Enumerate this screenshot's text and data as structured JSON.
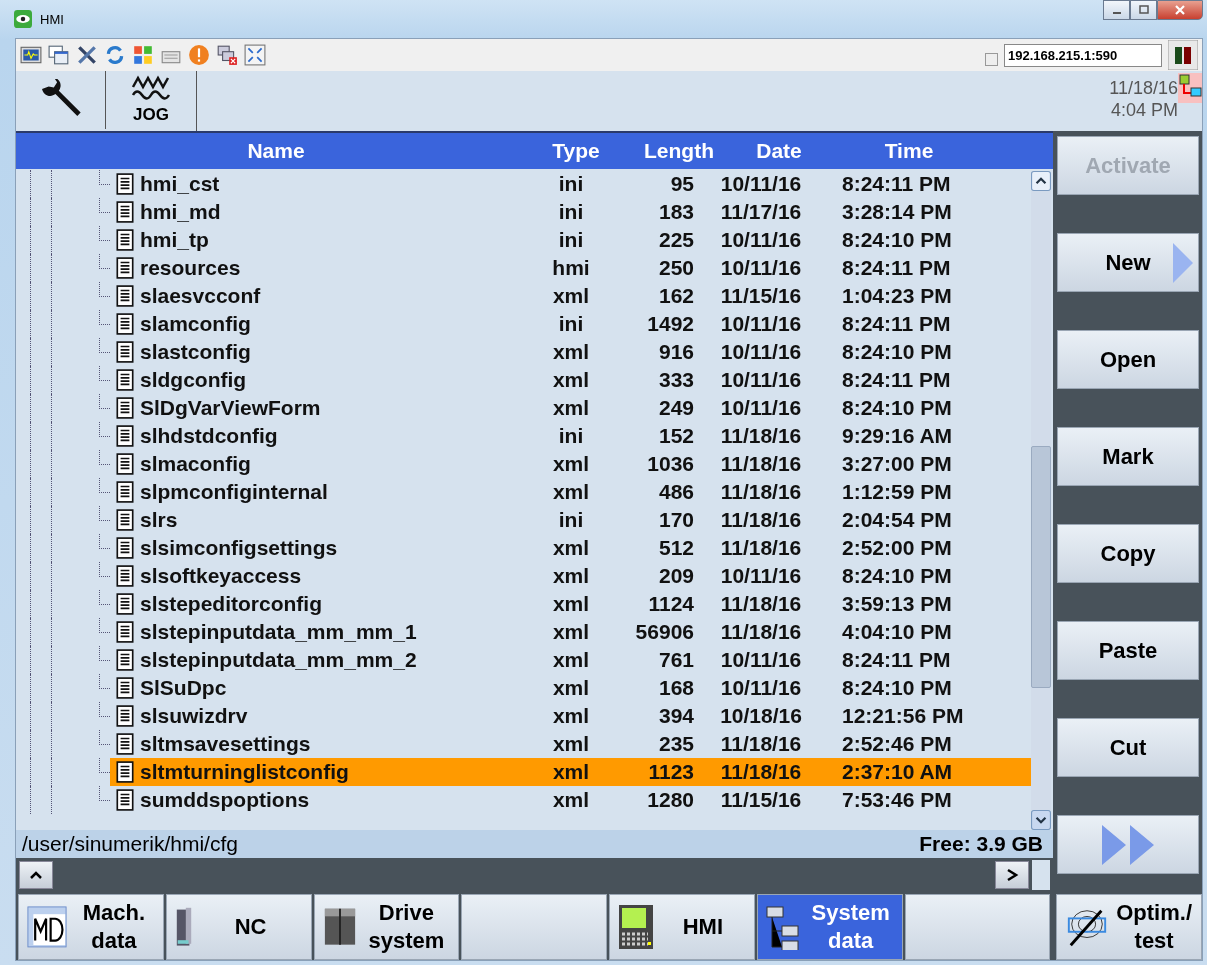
{
  "window": {
    "title": "HMI"
  },
  "connection": {
    "checked": false,
    "address": "192.168.215.1:590"
  },
  "header": {
    "mode": "JOG",
    "date": "11/18/16",
    "time": "4:04 PM"
  },
  "table": {
    "columns": [
      "Name",
      "Type",
      "Length",
      "Date",
      "Time"
    ],
    "rows": [
      {
        "name": "hmi_cst",
        "type": "ini",
        "length": "95",
        "date": "10/11/16",
        "time": "8:24:11 PM",
        "selected": false
      },
      {
        "name": "hmi_md",
        "type": "ini",
        "length": "183",
        "date": "11/17/16",
        "time": "3:28:14 PM",
        "selected": false
      },
      {
        "name": "hmi_tp",
        "type": "ini",
        "length": "225",
        "date": "10/11/16",
        "time": "8:24:10 PM",
        "selected": false
      },
      {
        "name": "resources",
        "type": "hmi",
        "length": "250",
        "date": "10/11/16",
        "time": "8:24:11 PM",
        "selected": false
      },
      {
        "name": "slaesvcconf",
        "type": "xml",
        "length": "162",
        "date": "11/15/16",
        "time": "1:04:23 PM",
        "selected": false
      },
      {
        "name": "slamconfig",
        "type": "ini",
        "length": "1492",
        "date": "10/11/16",
        "time": "8:24:11 PM",
        "selected": false
      },
      {
        "name": "slastconfig",
        "type": "xml",
        "length": "916",
        "date": "10/11/16",
        "time": "8:24:10 PM",
        "selected": false
      },
      {
        "name": "sldgconfig",
        "type": "xml",
        "length": "333",
        "date": "10/11/16",
        "time": "8:24:11 PM",
        "selected": false
      },
      {
        "name": "SlDgVarViewForm",
        "type": "xml",
        "length": "249",
        "date": "10/11/16",
        "time": "8:24:10 PM",
        "selected": false
      },
      {
        "name": "slhdstdconfig",
        "type": "ini",
        "length": "152",
        "date": "11/18/16",
        "time": "9:29:16 AM",
        "selected": false
      },
      {
        "name": "slmaconfig",
        "type": "xml",
        "length": "1036",
        "date": "11/18/16",
        "time": "3:27:00 PM",
        "selected": false
      },
      {
        "name": "slpmconfiginternal",
        "type": "xml",
        "length": "486",
        "date": "11/18/16",
        "time": "1:12:59 PM",
        "selected": false
      },
      {
        "name": "slrs",
        "type": "ini",
        "length": "170",
        "date": "11/18/16",
        "time": "2:04:54 PM",
        "selected": false
      },
      {
        "name": "slsimconfigsettings",
        "type": "xml",
        "length": "512",
        "date": "11/18/16",
        "time": "2:52:00 PM",
        "selected": false
      },
      {
        "name": "slsoftkeyaccess",
        "type": "xml",
        "length": "209",
        "date": "10/11/16",
        "time": "8:24:10 PM",
        "selected": false
      },
      {
        "name": "slstepeditorconfig",
        "type": "xml",
        "length": "1124",
        "date": "11/18/16",
        "time": "3:59:13 PM",
        "selected": false
      },
      {
        "name": "slstepinputdata_mm_mm_1",
        "type": "xml",
        "length": "56906",
        "date": "11/18/16",
        "time": "4:04:10 PM",
        "selected": false
      },
      {
        "name": "slstepinputdata_mm_mm_2",
        "type": "xml",
        "length": "761",
        "date": "10/11/16",
        "time": "8:24:11 PM",
        "selected": false
      },
      {
        "name": "SlSuDpc",
        "type": "xml",
        "length": "168",
        "date": "10/11/16",
        "time": "8:24:10 PM",
        "selected": false
      },
      {
        "name": "slsuwizdrv",
        "type": "xml",
        "length": "394",
        "date": "10/18/16",
        "time": "12:21:56 PM",
        "selected": false
      },
      {
        "name": "sltmsavesettings",
        "type": "xml",
        "length": "235",
        "date": "11/18/16",
        "time": "2:52:46 PM",
        "selected": false
      },
      {
        "name": "sltmturninglistconfig",
        "type": "xml",
        "length": "1123",
        "date": "11/18/16",
        "time": "2:37:10 AM",
        "selected": true
      },
      {
        "name": "sumddspoptions",
        "type": "xml",
        "length": "1280",
        "date": "11/15/16",
        "time": "7:53:46 PM",
        "selected": false
      }
    ]
  },
  "status": {
    "path": "/user/sinumerik/hmi/cfg",
    "free": "Free: 3.9 GB"
  },
  "softkeys_right": [
    {
      "kind": "text",
      "label": "Activate",
      "disabled": true
    },
    {
      "kind": "submenu",
      "label": "New",
      "disabled": false
    },
    {
      "kind": "text",
      "label": "Open",
      "disabled": false
    },
    {
      "kind": "text",
      "label": "Mark",
      "disabled": false
    },
    {
      "kind": "text",
      "label": "Copy",
      "disabled": false
    },
    {
      "kind": "text",
      "label": "Paste",
      "disabled": false
    },
    {
      "kind": "text",
      "label": "Cut",
      "disabled": false
    },
    {
      "kind": "more"
    }
  ],
  "softkeys_bottom": [
    {
      "kind": "md",
      "lines": [
        "Mach.",
        "data"
      ],
      "selected": false
    },
    {
      "kind": "nc",
      "lines": [
        "NC"
      ],
      "selected": false
    },
    {
      "kind": "drive",
      "lines": [
        "Drive",
        "system"
      ],
      "selected": false
    },
    {
      "kind": "blank",
      "selected": false
    },
    {
      "kind": "hmi",
      "lines": [
        "HMI"
      ],
      "selected": false
    },
    {
      "kind": "tree",
      "lines": [
        "System",
        "data"
      ],
      "selected": true
    },
    {
      "kind": "blank",
      "selected": false
    },
    {
      "kind": "optim",
      "lines": [
        "Optim./",
        "test"
      ],
      "selected": false
    }
  ]
}
